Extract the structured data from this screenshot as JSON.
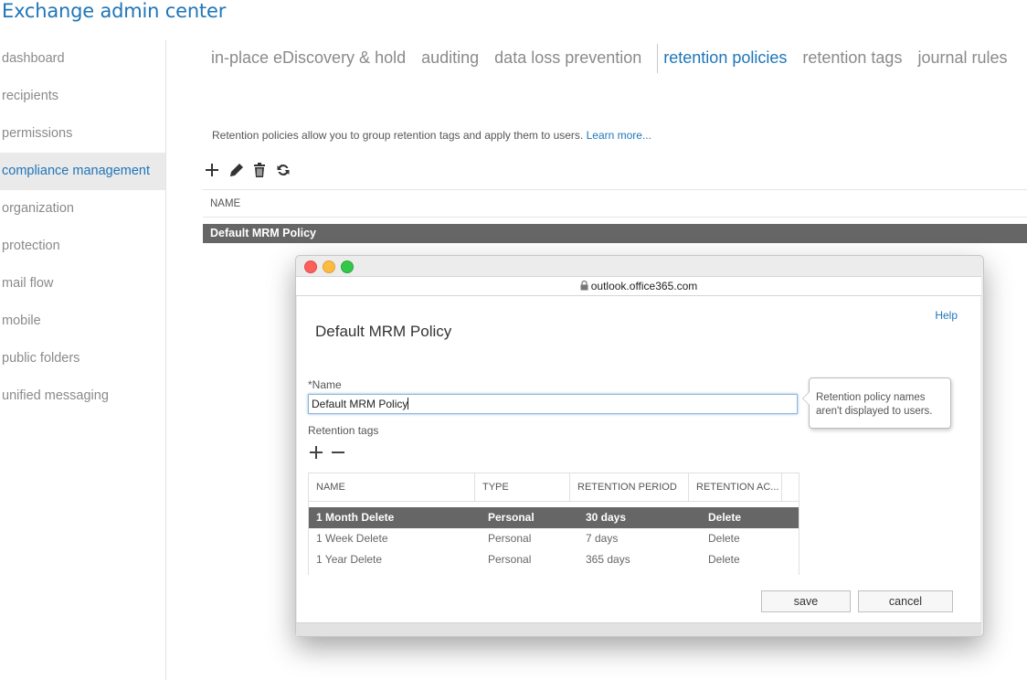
{
  "app": {
    "title": "Exchange admin center"
  },
  "nav": {
    "items": [
      {
        "label": "dashboard"
      },
      {
        "label": "recipients"
      },
      {
        "label": "permissions"
      },
      {
        "label": "compliance management"
      },
      {
        "label": "organization"
      },
      {
        "label": "protection"
      },
      {
        "label": "mail flow"
      },
      {
        "label": "mobile"
      },
      {
        "label": "public folders"
      },
      {
        "label": "unified messaging"
      }
    ],
    "active": "compliance management"
  },
  "tabs": [
    {
      "label": "in-place eDiscovery & hold"
    },
    {
      "label": "auditing"
    },
    {
      "label": "data loss prevention"
    },
    {
      "label": "retention policies"
    },
    {
      "label": "retention tags"
    },
    {
      "label": "journal rules"
    }
  ],
  "active_tab": "retention policies",
  "main": {
    "description": "Retention policies allow you to group retention tags and apply them to users.",
    "learn_more": "Learn more...",
    "list_header": "NAME",
    "rows": [
      "Default MRM Policy"
    ]
  },
  "popup": {
    "url": "outlook.office365.com",
    "dialog_title": "Default MRM Policy",
    "help": "Help",
    "name_label": "*Name",
    "name_value": "Default MRM Policy",
    "tooltip": "Retention policy names aren't displayed to users.",
    "retention_tags_label": "Retention tags",
    "table": {
      "headers": [
        "NAME",
        "TYPE",
        "RETENTION PERIOD",
        "RETENTION AC..."
      ],
      "rows": [
        [
          "1 Month Delete",
          "Personal",
          "30 days",
          "Delete"
        ],
        [
          "1 Week Delete",
          "Personal",
          "7 days",
          "Delete"
        ],
        [
          "1 Year Delete",
          "Personal",
          "365 days",
          "Delete"
        ]
      ],
      "selected_row": 0
    },
    "save": "save",
    "cancel": "cancel"
  },
  "colors": {
    "accent": "#1f75b8",
    "selected_row": "#666666"
  }
}
